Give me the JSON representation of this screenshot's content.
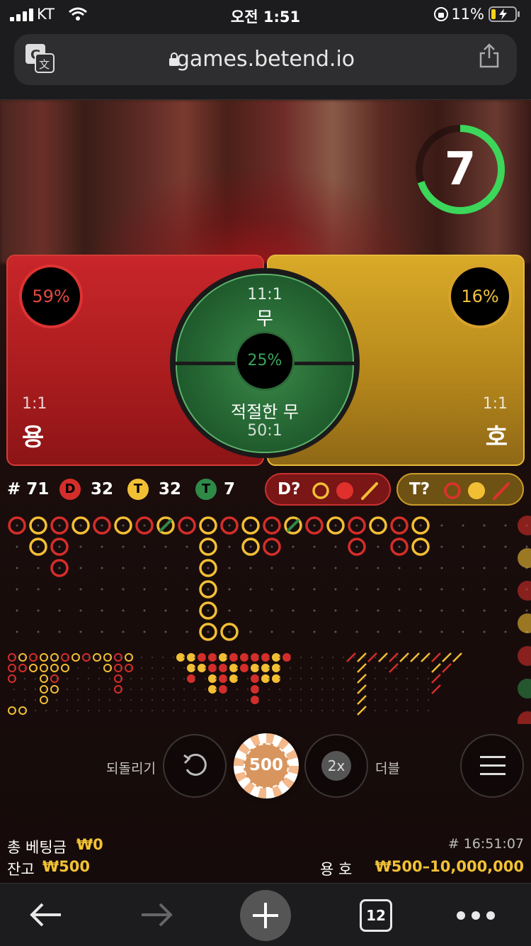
{
  "status_bar": {
    "carrier": "KT",
    "time": "오전 1:51",
    "battery": "11%"
  },
  "browser": {
    "url": "games.betend.io",
    "tab_count": "12"
  },
  "game": {
    "timer": "7",
    "timer_progress": 0.7,
    "dragon": {
      "label": "용",
      "odds": "1:1",
      "percent": "59%"
    },
    "tiger": {
      "label": "호",
      "odds": "1:1",
      "percent": "16%"
    },
    "tie": {
      "label": "무",
      "odds": "11:1",
      "percent": "25%",
      "suited_label": "적절한 무",
      "suited_odds": "50:1"
    }
  },
  "stats": {
    "total": "# 71",
    "dragon_badge": "D",
    "dragon_count": "32",
    "tiger_badge": "T",
    "tiger_count": "32",
    "tie_badge": "T",
    "tie_count": "7",
    "predict_dragon": "D?",
    "predict_tiger": "T?"
  },
  "controls": {
    "undo_label": "되돌리기",
    "chip_value": "500",
    "double_btn": "2x",
    "double_label": "더블"
  },
  "footer": {
    "total_bet_label": "총 베팅금",
    "total_bet_value": "₩0",
    "balance_label": "잔고",
    "balance_value": "₩500",
    "round_id": "# 16:51:07",
    "limit_label": "용 호",
    "limit_value": "₩500–10,000,000"
  },
  "colors": {
    "dragon": "#d33a34",
    "tiger": "#f0c040",
    "tie": "#2e8b46",
    "accent_green": "#3cd65a"
  }
}
